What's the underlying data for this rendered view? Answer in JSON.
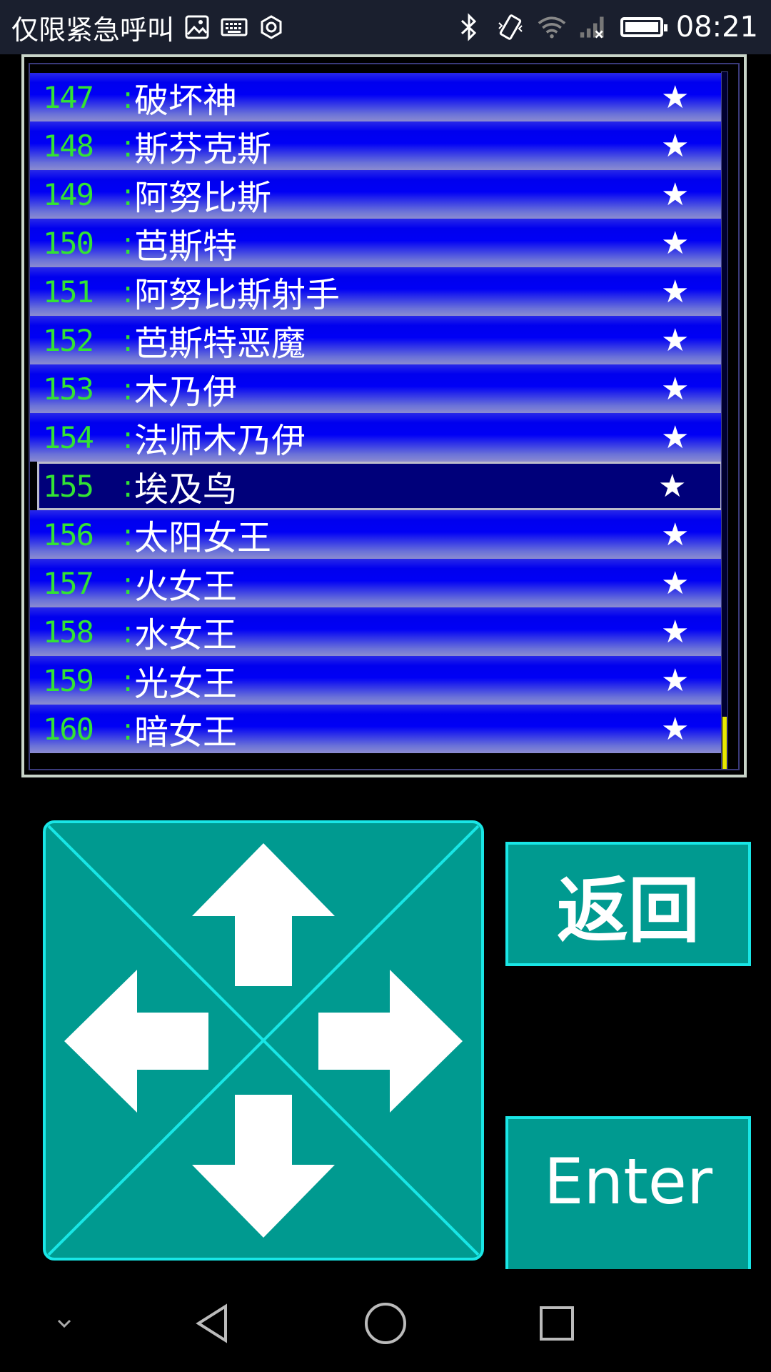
{
  "status_bar": {
    "left_text": "仅限紧急呼叫",
    "time": "08:21",
    "icons": [
      "gallery-icon",
      "keyboard-icon",
      "settings-hex-icon",
      "bluetooth-icon",
      "vibrate-icon",
      "wifi-icon",
      "signal-icon",
      "battery-icon"
    ]
  },
  "list": {
    "selected_index": 8,
    "rows": [
      {
        "num": "147",
        "sep": ":",
        "name": "破坏神",
        "mark": "★"
      },
      {
        "num": "148",
        "sep": ":",
        "name": "斯芬克斯",
        "mark": "★"
      },
      {
        "num": "149",
        "sep": ":",
        "name": "阿努比斯",
        "mark": "★"
      },
      {
        "num": "150",
        "sep": ":",
        "name": "芭斯特",
        "mark": "★"
      },
      {
        "num": "151",
        "sep": ":",
        "name": "阿努比斯射手",
        "mark": "★"
      },
      {
        "num": "152",
        "sep": ":",
        "name": "芭斯特恶魔",
        "mark": "★"
      },
      {
        "num": "153",
        "sep": ":",
        "name": "木乃伊",
        "mark": "★"
      },
      {
        "num": "154",
        "sep": ":",
        "name": "法师木乃伊",
        "mark": "★"
      },
      {
        "num": "155",
        "sep": ":",
        "name": "埃及鸟",
        "mark": "★"
      },
      {
        "num": "156",
        "sep": ":",
        "name": "太阳女王",
        "mark": "★"
      },
      {
        "num": "157",
        "sep": ":",
        "name": "火女王",
        "mark": "★"
      },
      {
        "num": "158",
        "sep": ":",
        "name": "水女王",
        "mark": "★"
      },
      {
        "num": "159",
        "sep": ":",
        "name": "光女王",
        "mark": "★"
      },
      {
        "num": "160",
        "sep": ":",
        "name": "暗女王",
        "mark": "★"
      }
    ]
  },
  "controls": {
    "back_label": "返回",
    "enter_label": "Enter",
    "dpad_color": "#009a90",
    "border_color": "#19e6e6"
  },
  "navbar": {
    "icons": [
      "collapse-icon",
      "back-triangle-icon",
      "home-circle-icon",
      "recents-square-icon"
    ]
  }
}
